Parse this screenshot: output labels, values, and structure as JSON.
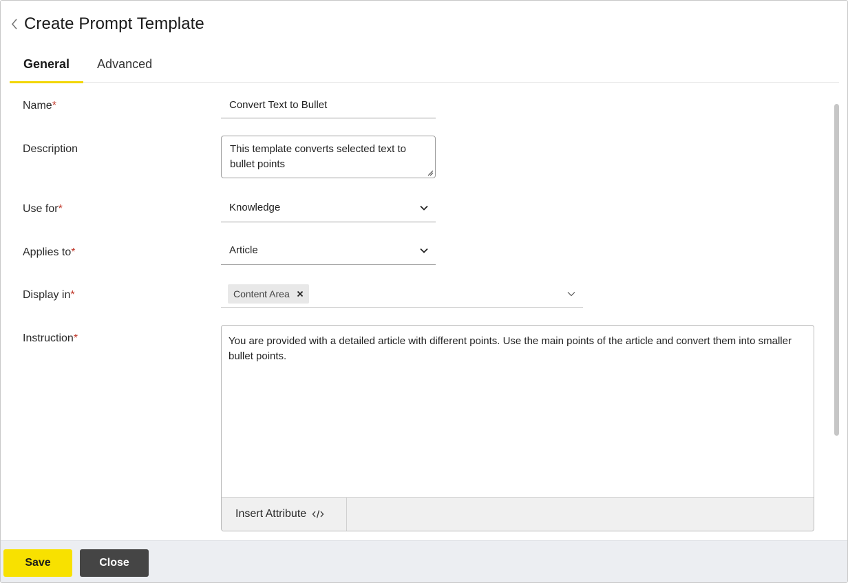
{
  "header": {
    "title": "Create Prompt Template",
    "back_icon": "chevron-left-icon"
  },
  "tabs": [
    {
      "label": "General",
      "active": true
    },
    {
      "label": "Advanced",
      "active": false
    }
  ],
  "form": {
    "name": {
      "label": "Name",
      "required_mark": "*",
      "value": "Convert Text to Bullet"
    },
    "description": {
      "label": "Description",
      "value": "This template converts selected text to bullet points"
    },
    "use_for": {
      "label": "Use for",
      "required_mark": "*",
      "value": "Knowledge"
    },
    "applies_to": {
      "label": "Applies to",
      "required_mark": "*",
      "value": "Article"
    },
    "display_in": {
      "label": "Display in",
      "required_mark": "*",
      "chips": [
        "Content Area"
      ]
    },
    "instruction": {
      "label": "Instruction",
      "required_mark": "*",
      "value": "You are provided with a detailed article with different points. Use the main points of the article and convert them into smaller bullet points.",
      "insert_attribute_label": "Insert Attribute"
    }
  },
  "footer": {
    "save_label": "Save",
    "close_label": "Close"
  },
  "colors": {
    "accent_yellow": "#f8e100",
    "tab_underline": "#f2d600",
    "required_red": "#c0392b",
    "close_button": "#454545",
    "footer_bg": "#eceef2"
  }
}
